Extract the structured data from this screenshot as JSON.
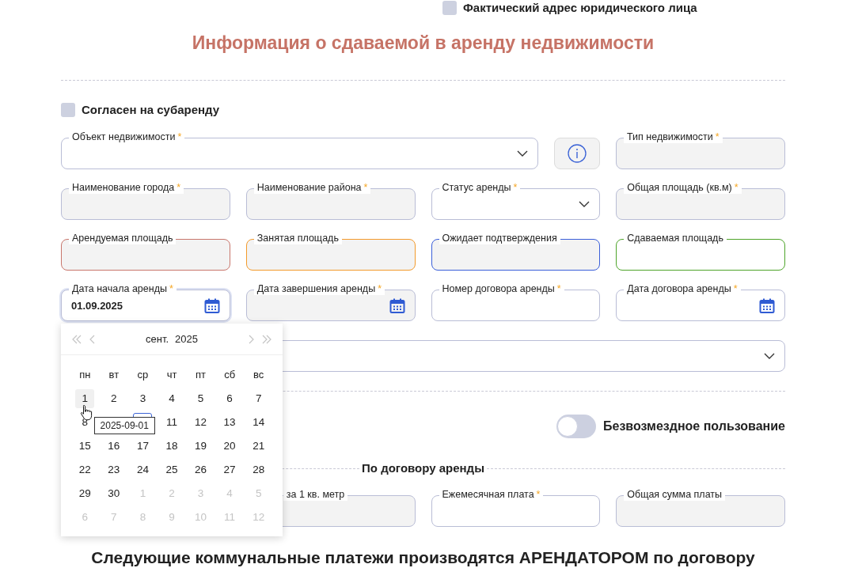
{
  "top_checkbox": {
    "label": "Фактический адрес юридического лица",
    "checked": false
  },
  "section_title": "Информация о сдаваемой в аренду недвижимости",
  "sublease_checkbox": {
    "label": "Согласен на субаренду",
    "checked": false
  },
  "property_object": {
    "label": "Объект недвижимости",
    "required_mark": "*"
  },
  "property_type": {
    "label": "Тип недвижимости",
    "required_mark": "*"
  },
  "grid_fields": [
    {
      "kind": "text",
      "label": "Наименование города",
      "required_mark": "*",
      "readonly": true,
      "focused": false
    },
    {
      "kind": "text",
      "label": "Наименование района",
      "required_mark": "*",
      "readonly": true,
      "focused": false
    },
    {
      "kind": "select",
      "label": "Статус аренды",
      "required_mark": "*",
      "readonly": false,
      "focused": false
    },
    {
      "kind": "text",
      "label": "Общая площадь (кв.м)",
      "required_mark": "*",
      "readonly": true,
      "focused": false
    },
    {
      "kind": "text",
      "label": "Арендуемая площадь",
      "readonly": true,
      "focused": false,
      "color": "#c8766c"
    },
    {
      "kind": "text",
      "label": "Занятая площадь",
      "readonly": true,
      "focused": false,
      "color": "#f39a2b"
    },
    {
      "kind": "text",
      "label": "Ожидает подтверждения",
      "readonly": true,
      "focused": false,
      "color": "#3b5fd9"
    },
    {
      "kind": "text",
      "label": "Сдаваемая площадь",
      "readonly": false,
      "focused": false,
      "color": "#4ea42a"
    },
    {
      "kind": "date",
      "label": "Дата начала аренды",
      "required_mark": "*",
      "readonly": false,
      "focused": true,
      "value": "01.09.2025"
    },
    {
      "kind": "date",
      "label": "Дата завершения аренды",
      "required_mark": "*",
      "readonly": true,
      "focused": false
    },
    {
      "kind": "text",
      "label": "Номер договора аренды",
      "required_mark": "*",
      "readonly": false,
      "focused": false
    },
    {
      "kind": "date",
      "label": "Дата договора аренды",
      "required_mark": "*",
      "readonly": false,
      "focused": false
    }
  ],
  "calendar": {
    "month": "сент.",
    "year": "2025",
    "weekdays": [
      "пн",
      "вт",
      "ср",
      "чт",
      "пт",
      "сб",
      "вс"
    ],
    "weeks": [
      [
        {
          "day": "1",
          "muted": false,
          "hovered": true,
          "today": false
        },
        {
          "day": "2",
          "muted": false,
          "hovered": false,
          "today": false
        },
        {
          "day": "3",
          "muted": false,
          "hovered": false,
          "today": false
        },
        {
          "day": "4",
          "muted": false,
          "hovered": false,
          "today": false
        },
        {
          "day": "5",
          "muted": false,
          "hovered": false,
          "today": false
        },
        {
          "day": "6",
          "muted": false,
          "hovered": false,
          "today": false
        },
        {
          "day": "7",
          "muted": false,
          "hovered": false,
          "today": false
        }
      ],
      [
        {
          "day": "8",
          "muted": false,
          "hovered": false,
          "today": false
        },
        {
          "kind": "tooltip",
          "text": "2025-09-01"
        },
        {
          "muted": false,
          "hovered": false,
          "today": true
        },
        {
          "day": "11",
          "muted": false,
          "hovered": false,
          "today": false
        },
        {
          "day": "12",
          "muted": false,
          "hovered": false,
          "today": false
        },
        {
          "day": "13",
          "muted": false,
          "hovered": false,
          "today": false
        },
        {
          "day": "14",
          "muted": false,
          "hovered": false,
          "today": false
        }
      ],
      [
        {
          "day": "15",
          "muted": false,
          "hovered": false,
          "today": false
        },
        {
          "day": "16",
          "muted": false,
          "hovered": false,
          "today": false
        },
        {
          "day": "17",
          "muted": false,
          "hovered": false,
          "today": false
        },
        {
          "day": "18",
          "muted": false,
          "hovered": false,
          "today": false
        },
        {
          "day": "19",
          "muted": false,
          "hovered": false,
          "today": false
        },
        {
          "day": "20",
          "muted": false,
          "hovered": false,
          "today": false
        },
        {
          "day": "21",
          "muted": false,
          "hovered": false,
          "today": false
        }
      ],
      [
        {
          "day": "22",
          "muted": false,
          "hovered": false,
          "today": false
        },
        {
          "day": "23",
          "muted": false,
          "hovered": false,
          "today": false
        },
        {
          "day": "24",
          "muted": false,
          "hovered": false,
          "today": false
        },
        {
          "day": "25",
          "muted": false,
          "hovered": false,
          "today": false
        },
        {
          "day": "26",
          "muted": false,
          "hovered": false,
          "today": false
        },
        {
          "day": "27",
          "muted": false,
          "hovered": false,
          "today": false
        },
        {
          "day": "28",
          "muted": false,
          "hovered": false,
          "today": false
        }
      ],
      [
        {
          "day": "29",
          "muted": false,
          "hovered": false,
          "today": false
        },
        {
          "day": "30",
          "muted": false,
          "hovered": false,
          "today": false
        },
        {
          "day": "1",
          "muted": true,
          "hovered": false,
          "today": false
        },
        {
          "day": "2",
          "muted": true,
          "hovered": false,
          "today": false
        },
        {
          "day": "3",
          "muted": true,
          "hovered": false,
          "today": false
        },
        {
          "day": "4",
          "muted": true,
          "hovered": false,
          "today": false
        },
        {
          "day": "5",
          "muted": true,
          "hovered": false,
          "today": false
        }
      ],
      [
        {
          "day": "6",
          "muted": true,
          "hovered": false,
          "today": false
        },
        {
          "day": "7",
          "muted": true,
          "hovered": false,
          "today": false
        },
        {
          "day": "8",
          "muted": true,
          "hovered": false,
          "today": false
        },
        {
          "day": "9",
          "muted": true,
          "hovered": false,
          "today": false
        },
        {
          "day": "10",
          "muted": true,
          "hovered": false,
          "today": false
        },
        {
          "day": "11",
          "muted": true,
          "hovered": false,
          "today": false
        },
        {
          "day": "12",
          "muted": true,
          "hovered": false,
          "today": false
        }
      ]
    ],
    "open": true
  },
  "free_use_toggle": {
    "label": "Безвозмездное пользование",
    "on": false
  },
  "payment_section": {
    "title": "По договору аренды",
    "fields": [
      {
        "label": "за 1 кв. метр",
        "readonly": true
      },
      {
        "label": "Ежемесячная плата",
        "required_mark": "*",
        "readonly": false
      },
      {
        "label": "Общая сумма платы",
        "readonly": true
      }
    ]
  },
  "utilities_heading": "Следующие коммунальные платежи производятся АРЕНДАТОРОМ по договору"
}
